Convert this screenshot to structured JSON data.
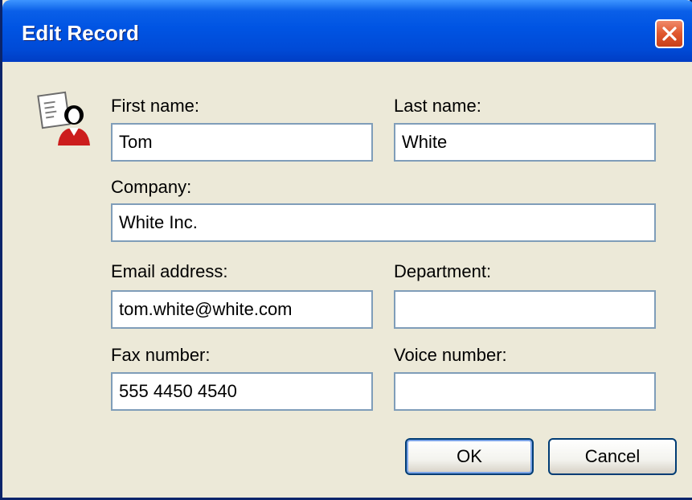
{
  "window": {
    "title": "Edit Record"
  },
  "form": {
    "first_name": {
      "label": "First name:",
      "value": "Tom"
    },
    "last_name": {
      "label": "Last name:",
      "value": "White"
    },
    "company": {
      "label": "Company:",
      "value": "White Inc."
    },
    "email": {
      "label": "Email address:",
      "value": "tom.white@white.com"
    },
    "department": {
      "label": "Department:",
      "value": ""
    },
    "fax": {
      "label": "Fax number:",
      "value": "555 4450 4540"
    },
    "voice": {
      "label": "Voice number:",
      "value": ""
    }
  },
  "buttons": {
    "ok": "OK",
    "cancel": "Cancel"
  },
  "icons": {
    "close": "close-icon",
    "record": "contact-card-icon"
  },
  "colors": {
    "titlebar": "#0054e3",
    "client": "#ece9d8",
    "close": "#e0572d",
    "field_border": "#7f9db9"
  }
}
